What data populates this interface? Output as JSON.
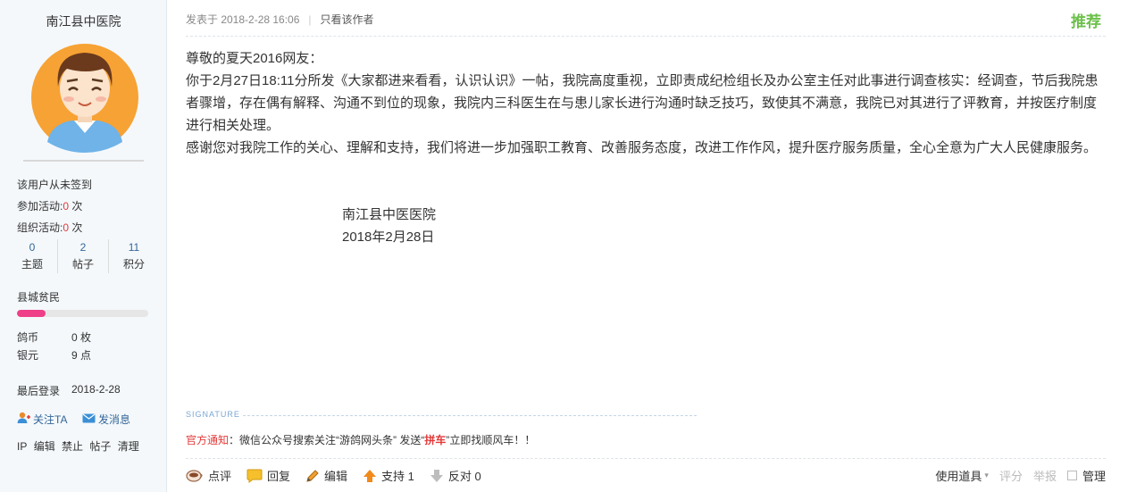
{
  "profile": {
    "username": "南江县中医院",
    "signin_text": "该用户从未签到",
    "activity_join_label": "参加活动:",
    "activity_join_count": "0",
    "activity_org_label": "组织活动:",
    "activity_org_count": "0",
    "times_unit": " 次",
    "counts": [
      {
        "num": "0",
        "label": "主题"
      },
      {
        "num": "2",
        "label": "帖子"
      },
      {
        "num": "11",
        "label": "积分"
      }
    ],
    "level_name": "县城贫民",
    "level_progress_fraction": 0.22,
    "currency": [
      {
        "label": "鸽币",
        "value": "0 枚"
      },
      {
        "label": "银元",
        "value": "9 点"
      }
    ],
    "last_login_label": "最后登录",
    "last_login_value": "2018-2-28",
    "follow_label": "关注TA",
    "message_label": "发消息",
    "admin_links": [
      "IP",
      "编辑",
      "禁止",
      "帖子",
      "清理"
    ]
  },
  "post": {
    "posted_at": "发表于 2018-2-28 16:06",
    "author_only": "只看该作者",
    "recommend": "推荐",
    "paragraphs": [
      "尊敬的夏天2016网友：",
      "你于2月27日18:11分所发《大家都进来看看，认识认识》一帖，我院高度重视，立即责成纪检组长及办公室主任对此事进行调查核实：经调查，节后我院患者骤增，存在偶有解释、沟通不到位的现象，我院内三科医生在与患儿家长进行沟通时缺乏技巧，致使其不满意，我院已对其进行了评教育，并按医疗制度进行相关处理。",
      "感谢您对我院工作的关心、理解和支持，我们将进一步加强职工教育、改善服务态度，改进工作作风，提升医疗服务质量，全心全意为广大人民健康服务。"
    ],
    "signature_org": "南江县中医医院",
    "signature_date": "2018年2月28日",
    "signature_label": "SIGNATURE",
    "notice_label": "官方通知",
    "notice_prefix": "：微信公众号搜索关注“游鸽网头条” 发送“",
    "notice_highlight": "拼车",
    "notice_suffix": "”立即找顺风车！！"
  },
  "actions": {
    "comment": "点评",
    "reply": "回复",
    "edit": "编辑",
    "support": "支持 1",
    "oppose": "反对 0"
  },
  "tools": {
    "use_tool": "使用道具",
    "rate": "评分",
    "report": "举报",
    "manage": "管理"
  },
  "colors": {
    "accent_green": "#6cc04a",
    "link_blue": "#336699",
    "alert_red": "#e23a3a",
    "level_pink": "#ee3f88"
  }
}
